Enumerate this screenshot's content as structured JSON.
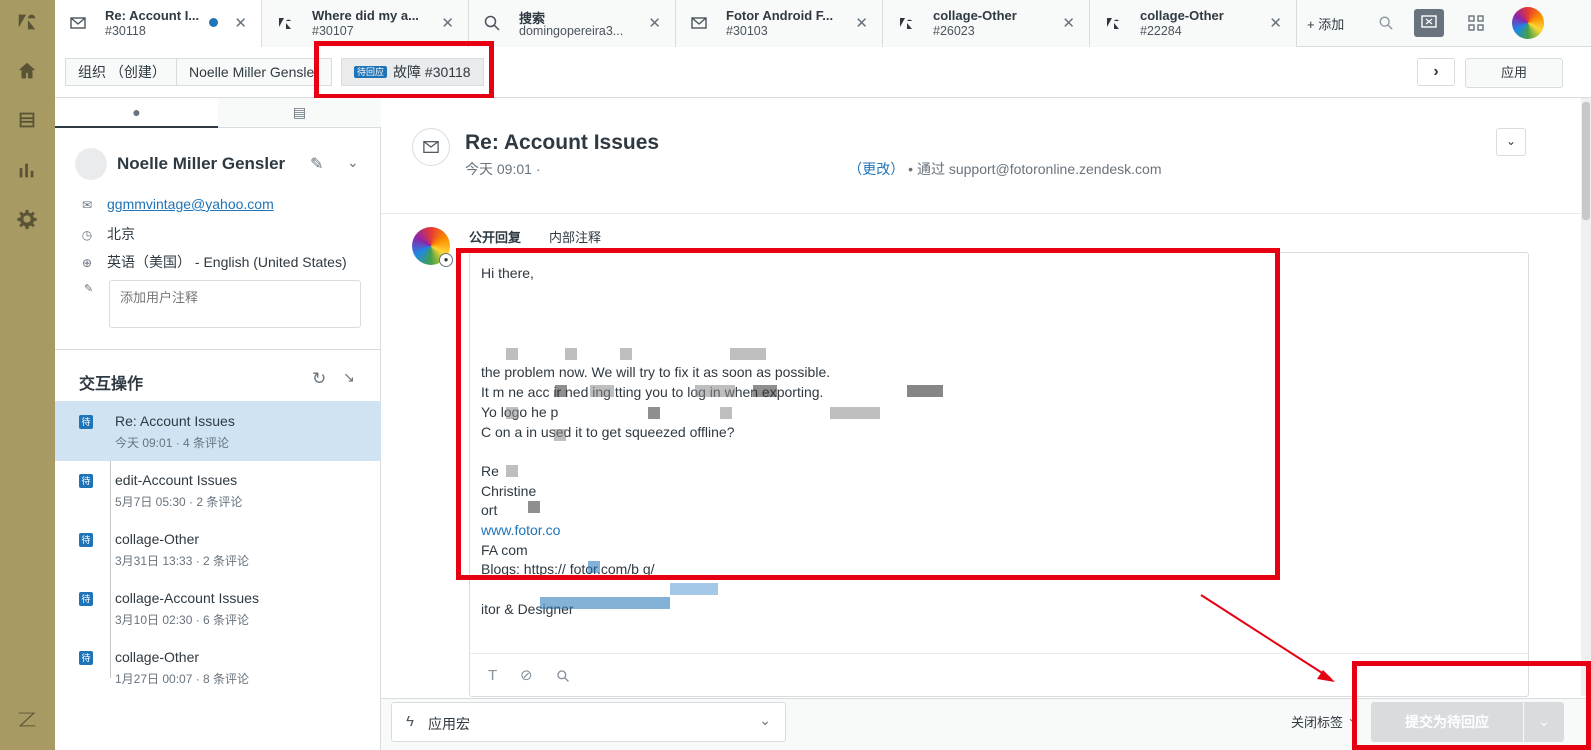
{
  "tabs": [
    {
      "title": "Re: Account I...",
      "subtitle": "#30118"
    },
    {
      "title": "Where did my a...",
      "subtitle": "#30107"
    },
    {
      "title": "搜索",
      "subtitle": "domingopereira3..."
    },
    {
      "title": "Fotor Android F...",
      "subtitle": "#30103"
    },
    {
      "title": "collage-Other",
      "subtitle": "#26023"
    },
    {
      "title": "collage-Other",
      "subtitle": "#22284"
    }
  ],
  "topbar": {
    "add_label": "+ 添加"
  },
  "breadcrumb": {
    "org": "组织 （创建）",
    "user": "Noelle Miller Gensler",
    "status_badge": "待回应",
    "ticket": "故障 #30118",
    "apply": "应用"
  },
  "user": {
    "name": "Noelle Miller Gensler",
    "email": "ggmmvintage@yahoo.com",
    "location": "北京",
    "language": "英语（美国） - English (United States)",
    "note_placeholder": "添加用户注释"
  },
  "interactions": {
    "title": "交互操作",
    "items": [
      {
        "badge": "待",
        "title": "Re: Account Issues",
        "meta": "今天 09:01 · 4 条评论"
      },
      {
        "badge": "待",
        "title": "edit-Account Issues",
        "meta": "5月7日 05:30 · 2 条评论"
      },
      {
        "badge": "待",
        "title": "collage-Other",
        "meta": "3月31日 13:33 · 2 条评论"
      },
      {
        "badge": "待",
        "title": "collage-Account Issues",
        "meta": "3月10日 02:30 · 6 条评论"
      },
      {
        "badge": "待",
        "title": "collage-Other",
        "meta": "1月27日 00:07 · 8 条评论"
      }
    ]
  },
  "ticket": {
    "subject": "Re: Account Issues",
    "time": "今天 09:01 ·",
    "change": "（更改）",
    "via": "• 通过 support@fotoronline.zendesk.com"
  },
  "composer": {
    "tab_public": "公开回复",
    "tab_internal": "内部注释",
    "lines": [
      "Hi there,",
      "",
      "",
      "",
      "                     the problem now. We will try to fix it as soon as possible.",
      "It m      ne              acc         ir   ned    ing            tting                                        you to log in when exporting.",
      "Yo                             logo                                              he p",
      "C                                                              on a                                      in                               used it to get squeezed offline?",
      "",
      "Re",
      "Christine",
      "                         ort",
      "www.fotor.co",
      "FA                                      com",
      "Blogs: https://        fotor.com/b    g/",
      "",
      "                                 itor & Designer"
    ]
  },
  "footer": {
    "macro": "应用宏",
    "close_tags": "关闭标签",
    "submit": "提交为待回应"
  }
}
